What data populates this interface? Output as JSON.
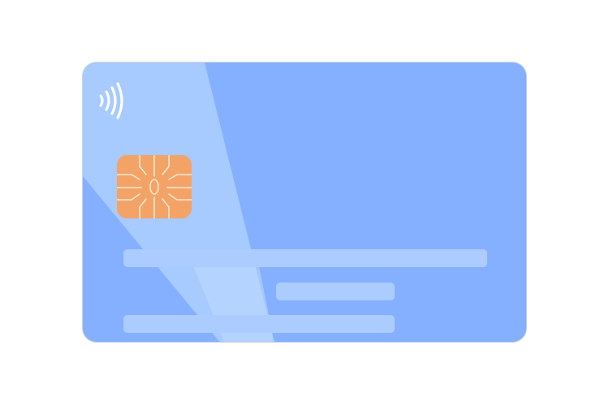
{
  "card": {
    "colors": {
      "base": "#85b0ff",
      "sheen": "#a9cbff",
      "sheen_strong": "#bfdbff",
      "bar": "#acccff",
      "chip": "#f4a366",
      "chip_lines": "#fde8d4",
      "contactless": "#ffffff"
    },
    "icons": {
      "contactless": "contactless-icon",
      "chip": "chip-icon"
    },
    "placeholder_bars": 3
  }
}
